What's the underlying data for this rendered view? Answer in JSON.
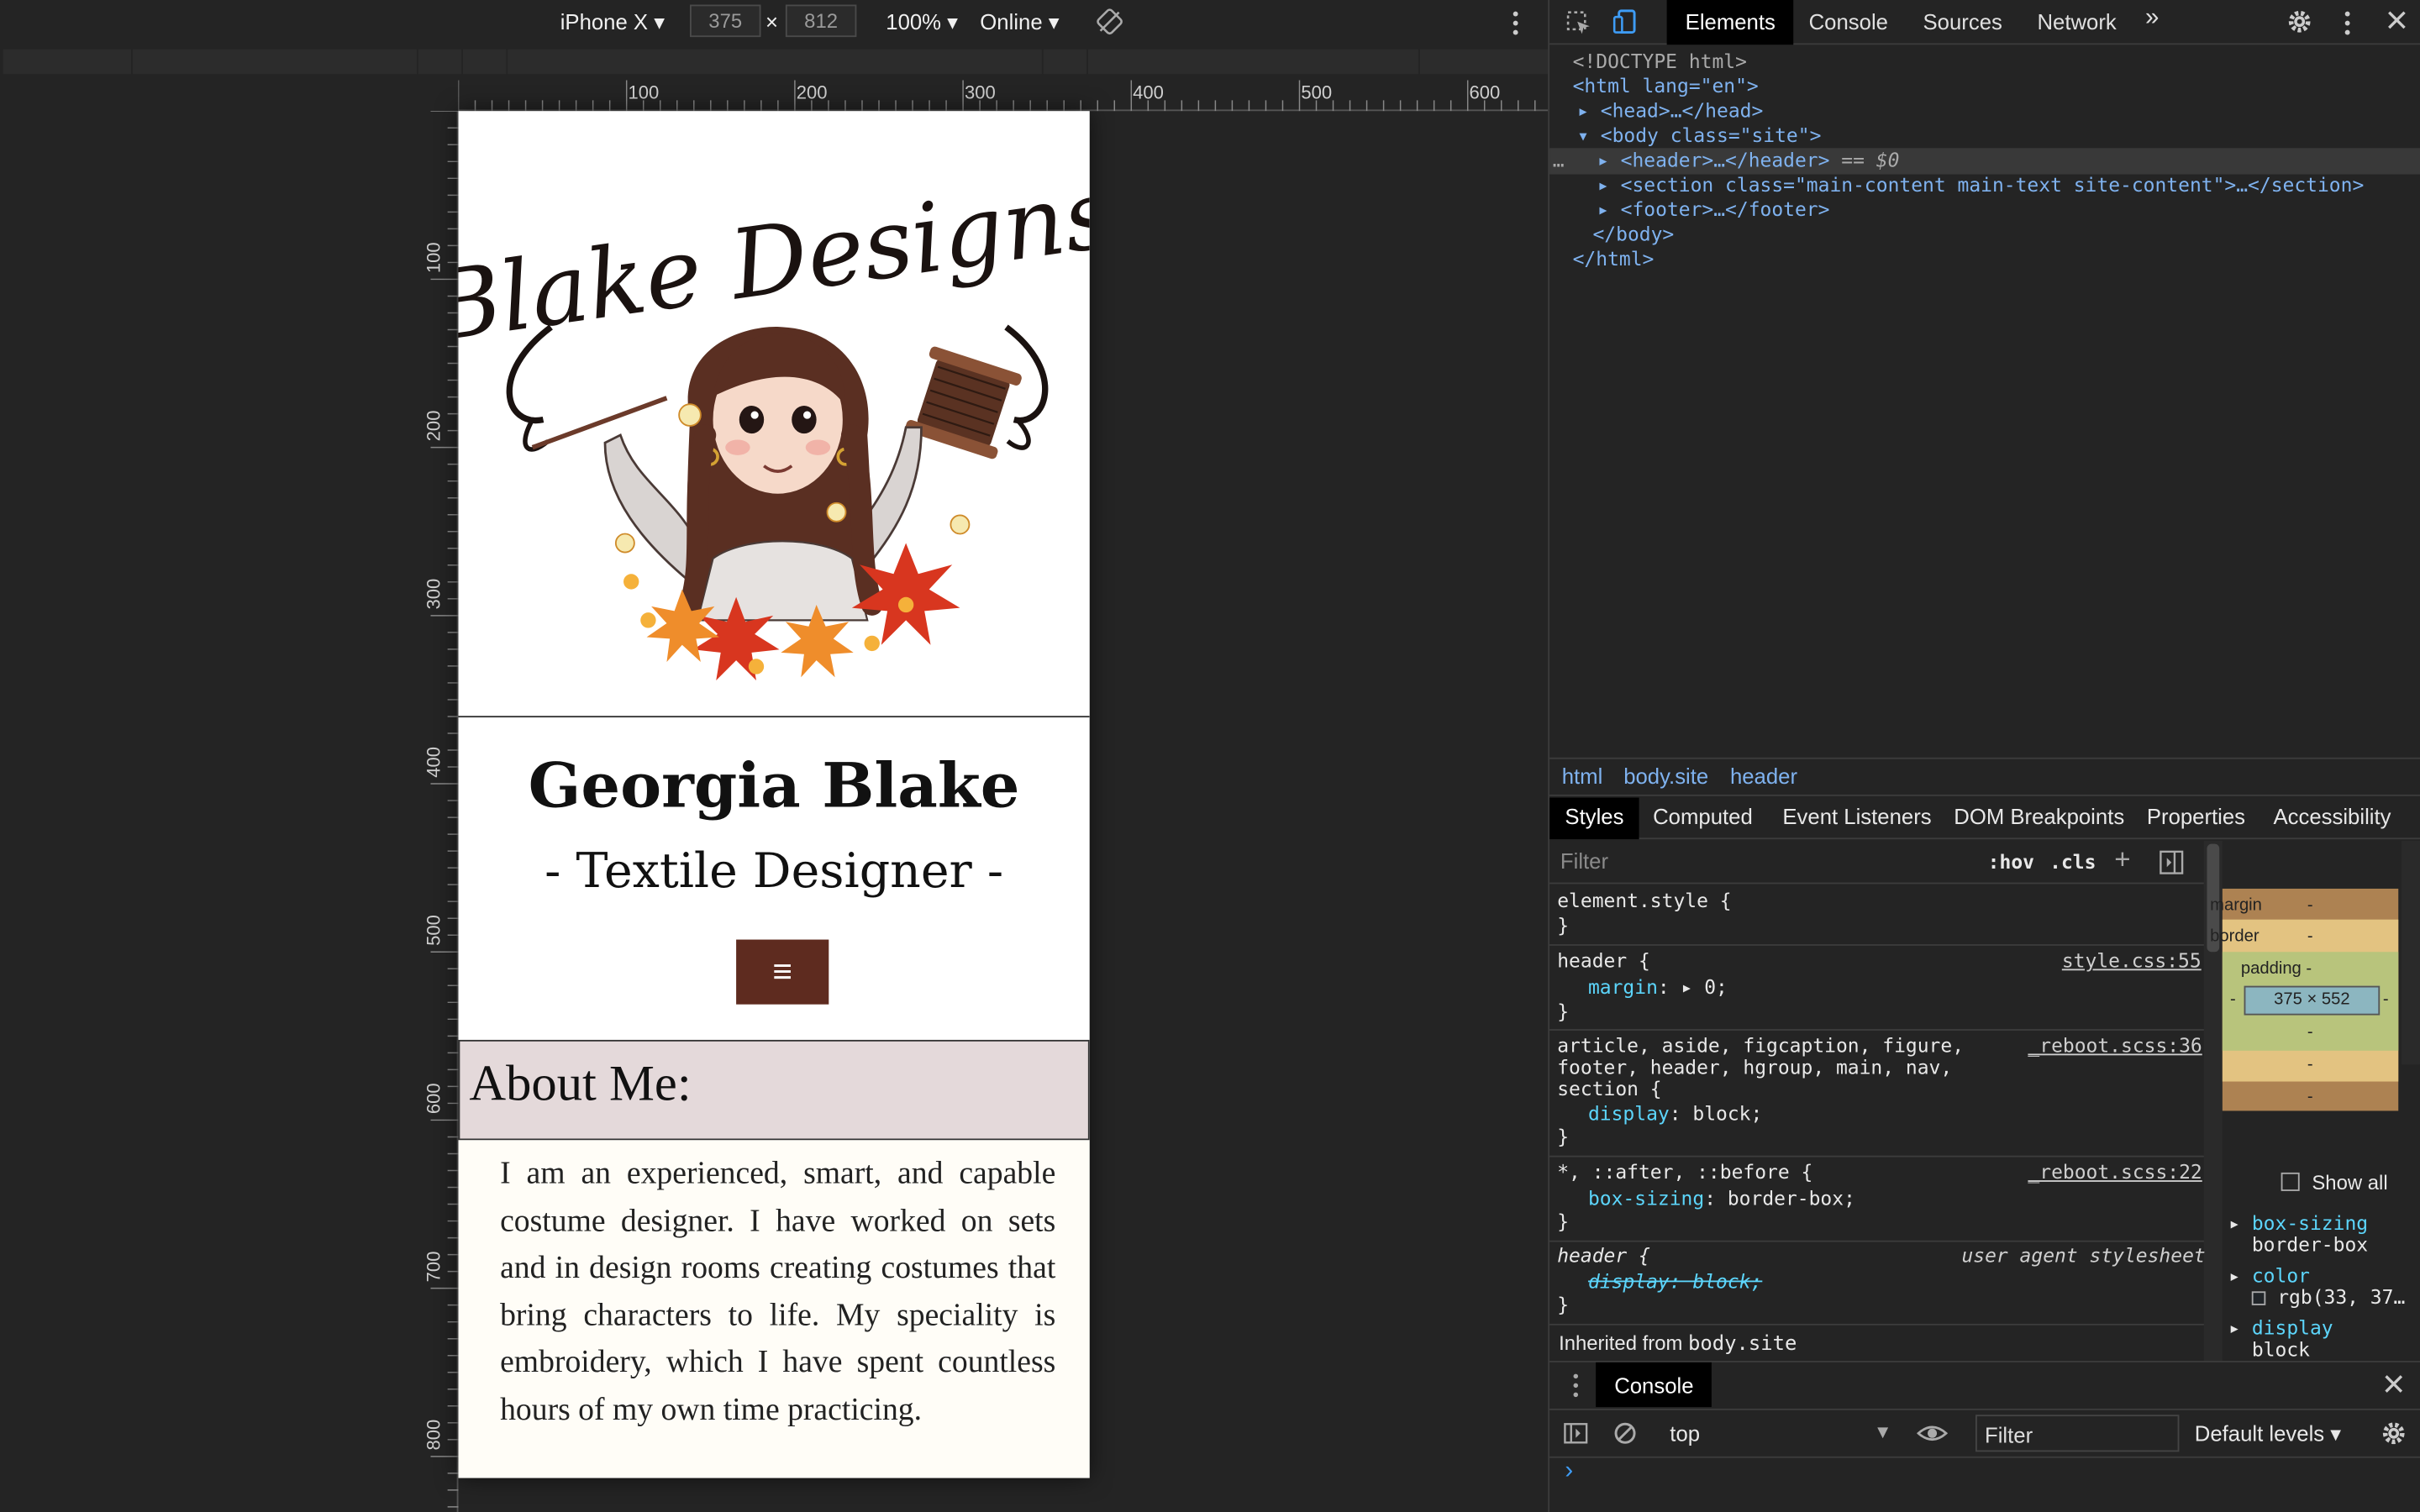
{
  "device_toolbar": {
    "device": "iPhone X",
    "width": "375",
    "times": "×",
    "height": "812",
    "zoom": "100%",
    "network": "Online",
    "rotate_icon": "rotate-icon",
    "more_icon": "more-vertical-icon"
  },
  "rulers": {
    "horizontal": [
      "100",
      "200",
      "300",
      "400",
      "500",
      "600"
    ],
    "vertical": [
      "100",
      "200",
      "300",
      "400",
      "500",
      "600",
      "700",
      "800"
    ]
  },
  "site": {
    "logo_text": "Blake Designs",
    "title": "Georgia Blake",
    "subtitle": "- Textile Designer -",
    "menu_icon": "≡",
    "about_title": "About Me:",
    "about_text": "I am an experienced, smart, and capable costume designer. I have worked on sets and in design rooms creating costumes that bring characters to life. My speciality is embroidery, which I have spent countless hours of my own time practicing.",
    "colors": {
      "menu_button": "#5e2b1f",
      "about_band": "#e4d9da",
      "about_body": "#fffdf7"
    }
  },
  "devtools": {
    "tabs": [
      "Elements",
      "Console",
      "Sources",
      "Network"
    ],
    "more_tabs": "»",
    "dom": {
      "doctype": "<!DOCTYPE html>",
      "html_open": "<html lang=\"en\">",
      "head": "<head>…</head>",
      "body_open": "<body class=\"site\">",
      "header": "<header>…</header>",
      "selected_marker": "== $0",
      "ellipsis": "…",
      "section": "<section class=\"main-content main-text site-content\">…</section>",
      "footer": "<footer>…</footer>",
      "body_close": "</body>",
      "html_close": "</html>"
    },
    "breadcrumbs": [
      "html",
      "body.site",
      "header"
    ],
    "styles_tabs": [
      "Styles",
      "Computed",
      "Event Listeners",
      "DOM Breakpoints",
      "Properties",
      "Accessibility"
    ],
    "filter_placeholder": "Filter",
    "hov": ":hov",
    "cls": ".cls",
    "plus": "+",
    "rules": {
      "element_style": "element.style {",
      "close": "}",
      "header_sel": "header {",
      "header_src": "style.css:55",
      "margin_prop": "margin",
      "margin_val": ": ▸ 0;",
      "reboot_sel1": "article, aside, figcaption, figure,",
      "reboot_sel2": "footer, header, hgroup, main, nav,",
      "reboot_sel3": "section {",
      "reboot_src1": "_reboot.scss:36",
      "display_prop": "display",
      "display_val": ": block;",
      "universal_sel": "*, ::after, ::before {",
      "reboot_src2": "_reboot.scss:22",
      "boxsizing_prop": "box-sizing",
      "boxsizing_val": ": border-box;",
      "ua_sel": "header {",
      "ua_src": "user agent stylesheet",
      "ua_struck": "display: block;",
      "inherited": "Inherited from",
      "inherited_src": "body.site"
    },
    "box_model": {
      "margin": "margin",
      "border": "border",
      "padding": "padding -",
      "dash": "-",
      "size": "375 × 552"
    },
    "computed": {
      "show_all": "Show all",
      "items": [
        {
          "prop": "box-sizing",
          "val": "border-box"
        },
        {
          "prop": "color",
          "val": "rgb(33, 37…"
        },
        {
          "prop": "display",
          "val": "block"
        }
      ]
    },
    "console": {
      "title": "Console",
      "context": "top",
      "filter": "Filter",
      "levels": "Default levels",
      "prompt": "›"
    }
  }
}
